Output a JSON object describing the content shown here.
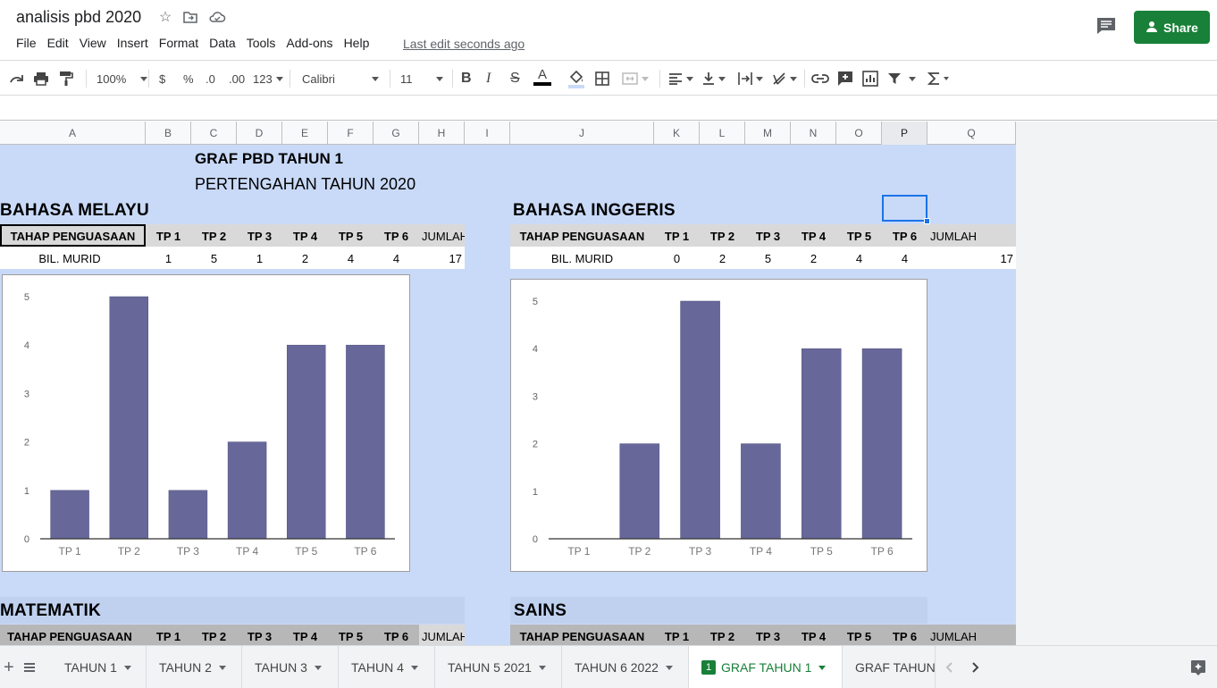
{
  "doc": {
    "title": "analisis pbd 2020",
    "last_edit": "Last edit seconds ago"
  },
  "menu": [
    "File",
    "Edit",
    "View",
    "Insert",
    "Format",
    "Data",
    "Tools",
    "Add-ons",
    "Help"
  ],
  "share_label": "Share",
  "toolbar": {
    "zoom": "100%",
    "currency": "$",
    "percent": "%",
    "dec_decrease": ".0",
    "dec_increase": ".00",
    "more_formats": "123",
    "font": "Calibri",
    "font_size": "11",
    "bold": "B",
    "italic": "I",
    "strike": "S",
    "text_color": "A"
  },
  "columns": [
    "A",
    "B",
    "C",
    "D",
    "E",
    "F",
    "G",
    "H",
    "I",
    "J",
    "K",
    "L",
    "M",
    "N",
    "O",
    "P",
    "Q"
  ],
  "selected_column": "P",
  "sheet": {
    "title": "GRAF PBD TAHUN 1",
    "subtitle": "PERTENGAHAN TAHUN 2020",
    "header_labels": [
      "TAHAP PENGUASAAN",
      "TP 1",
      "TP 2",
      "TP 3",
      "TP 4",
      "TP 5",
      "TP 6",
      "JUMLAH"
    ],
    "row_label": "BIL. MURID",
    "subjects": [
      {
        "name": "BAHASA MELAYU",
        "values": [
          "1",
          "5",
          "1",
          "2",
          "4",
          "4"
        ],
        "total": "17"
      },
      {
        "name": "BAHASA INGGERIS",
        "values": [
          "0",
          "2",
          "5",
          "2",
          "4",
          "4"
        ],
        "total": "17"
      },
      {
        "name": "MATEMATIK"
      },
      {
        "name": "SAINS"
      }
    ]
  },
  "chart_data": [
    {
      "type": "bar",
      "categories": [
        "TP 1",
        "TP 2",
        "TP 3",
        "TP 4",
        "TP 5",
        "TP 6"
      ],
      "values": [
        1,
        5,
        1,
        2,
        4,
        4
      ],
      "title": "",
      "xlabel": "",
      "ylabel": "",
      "ylim": [
        0,
        5
      ],
      "yticks": [
        0,
        1,
        2,
        3,
        4,
        5
      ],
      "color": "#67679a",
      "grid": false
    },
    {
      "type": "bar",
      "categories": [
        "TP 1",
        "TP 2",
        "TP 3",
        "TP 4",
        "TP 5",
        "TP 6"
      ],
      "values": [
        0,
        2,
        5,
        2,
        4,
        4
      ],
      "title": "",
      "xlabel": "",
      "ylabel": "",
      "ylim": [
        0,
        5
      ],
      "yticks": [
        0,
        1,
        2,
        3,
        4,
        5
      ],
      "color": "#67679a",
      "grid": false
    }
  ],
  "tabs": [
    {
      "label": "TAHUN 1",
      "active": false
    },
    {
      "label": "TAHUN 2",
      "active": false
    },
    {
      "label": "TAHUN 3",
      "active": false
    },
    {
      "label": "TAHUN 4",
      "active": false
    },
    {
      "label": "TAHUN 5 2021",
      "active": false
    },
    {
      "label": "TAHUN 6 2022",
      "active": false
    },
    {
      "label": "GRAF TAHUN 1",
      "active": true,
      "badge": "1"
    },
    {
      "label": "GRAF TAHUN",
      "active": false
    }
  ],
  "colors": {
    "accent": "#188038",
    "sheet_bg": "#c9daf8",
    "header_gray": "#d9d9d9",
    "bar": "#67679a"
  }
}
